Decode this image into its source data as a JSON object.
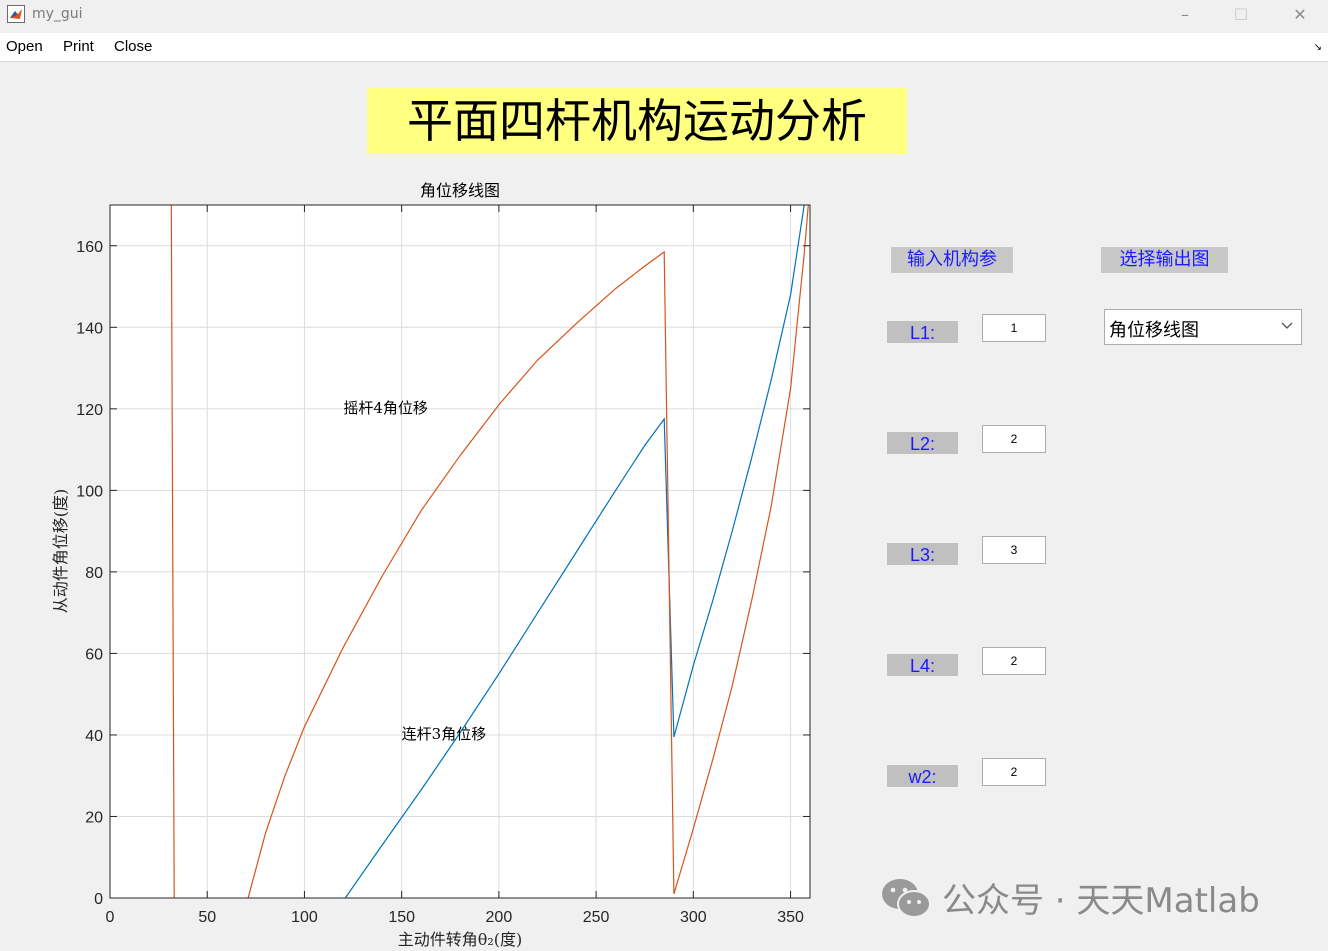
{
  "window": {
    "title": "my_gui",
    "controls": {
      "minimize": "–",
      "maximize": "☐",
      "close": "✕"
    }
  },
  "menu": {
    "items": [
      "Open",
      "Print",
      "Close"
    ],
    "dock_glyph": "↘"
  },
  "main_title": "平面四杆机构运动分析",
  "chart_data": {
    "type": "line",
    "title": "角位移线图",
    "xlabel": "主动件转角θ₂(度)",
    "ylabel": "从动件角位移(度)",
    "xlim": [
      0,
      360
    ],
    "ylim": [
      0,
      170
    ],
    "xticks": [
      0,
      50,
      100,
      150,
      200,
      250,
      300,
      350
    ],
    "yticks": [
      0,
      20,
      40,
      60,
      80,
      100,
      120,
      140,
      160
    ],
    "grid": true,
    "series": [
      {
        "name": "",
        "color": "#0072bd",
        "points": [
          [
            121,
            0
          ],
          [
            140,
            13
          ],
          [
            160,
            26.5
          ],
          [
            180,
            40.5
          ],
          [
            200,
            55
          ],
          [
            220,
            70
          ],
          [
            240,
            85
          ],
          [
            260,
            100
          ],
          [
            275,
            111
          ],
          [
            285,
            117.5
          ],
          [
            290,
            39.5
          ],
          [
            300,
            57
          ],
          [
            310,
            73
          ],
          [
            320,
            90
          ],
          [
            330,
            108
          ],
          [
            340,
            127
          ],
          [
            350,
            148
          ],
          [
            357,
            170
          ]
        ]
      },
      {
        "name": "",
        "color": "#d95319",
        "points": [
          [
            31.5,
            170
          ],
          [
            33,
            0
          ],
          [
            null,
            null
          ],
          [
            71,
            0
          ],
          [
            80,
            16
          ],
          [
            90,
            30
          ],
          [
            100,
            42
          ],
          [
            120,
            61.5
          ],
          [
            140,
            79
          ],
          [
            160,
            95
          ],
          [
            180,
            108.5
          ],
          [
            200,
            121
          ],
          [
            220,
            132
          ],
          [
            240,
            141
          ],
          [
            260,
            149.5
          ],
          [
            275,
            155
          ],
          [
            285,
            158.5
          ],
          [
            290,
            1
          ],
          [
            300,
            17
          ],
          [
            310,
            34
          ],
          [
            320,
            52
          ],
          [
            330,
            73
          ],
          [
            340,
            96
          ],
          [
            350,
            125
          ],
          [
            357,
            158
          ],
          [
            360,
            175
          ]
        ]
      }
    ],
    "annotations": [
      {
        "text": "摇杆4角位移",
        "x": 120,
        "y": 119
      },
      {
        "text": "连杆3角位移",
        "x": 150,
        "y": 39
      }
    ]
  },
  "panel": {
    "input_header": "输入机构参",
    "output_header": "选择输出图",
    "params": [
      {
        "label": "L1:",
        "value": "1"
      },
      {
        "label": "L2:",
        "value": "2"
      },
      {
        "label": "L3:",
        "value": "3"
      },
      {
        "label": "L4:",
        "value": "2"
      },
      {
        "label": "w2:",
        "value": "2"
      }
    ],
    "select_value": "角位移线图"
  },
  "watermark": "公众号 · 天天Matlab"
}
